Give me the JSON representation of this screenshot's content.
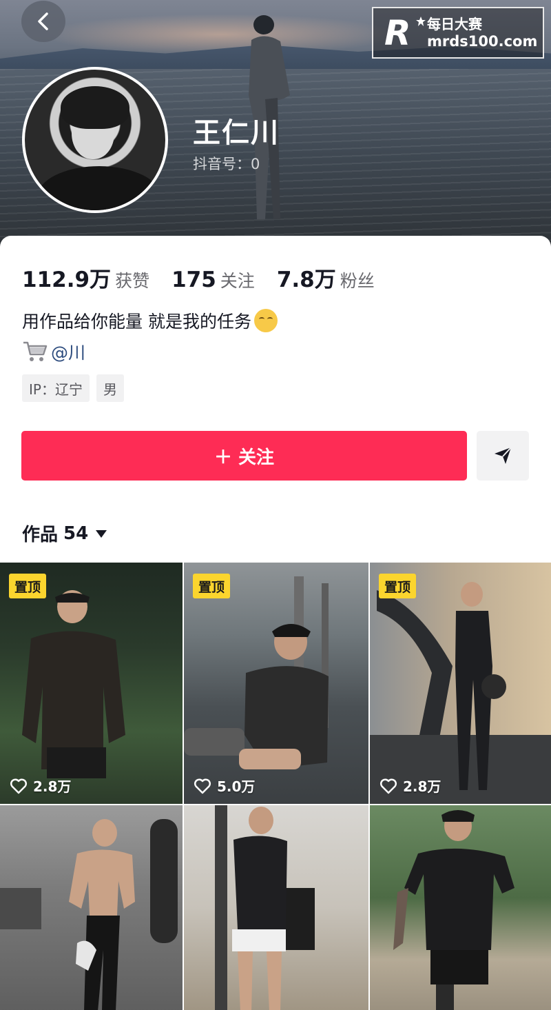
{
  "header": {
    "username": "王仁川",
    "douyin_id": "抖音号：0",
    "watermark_logo": "R",
    "watermark_cn": "每日大赛",
    "watermark_url": "mrds100.com"
  },
  "stats": [
    {
      "num": "112.9万",
      "label": "获赞"
    },
    {
      "num": "175",
      "label": "关注"
    },
    {
      "num": "7.8万",
      "label": "粉丝"
    }
  ],
  "bio": {
    "text": "用作品给你能量 就是我的任务",
    "shop_handle": "@川"
  },
  "tags": [
    "IP：辽宁",
    "男"
  ],
  "actions": {
    "follow_label": "＋ 关注"
  },
  "works": {
    "label": "作品",
    "count": "54"
  },
  "videos": [
    {
      "pinned_label": "置顶",
      "likes": "2.8万"
    },
    {
      "pinned_label": "置顶",
      "likes": "5.0万"
    },
    {
      "pinned_label": "置顶",
      "likes": "2.8万"
    },
    {
      "pinned_label": "",
      "likes": ""
    },
    {
      "pinned_label": "",
      "likes": ""
    },
    {
      "pinned_label": "",
      "likes": ""
    }
  ],
  "colors": {
    "follow_button": "#fe2c55",
    "pin_badge": "#fbd52e",
    "link": "#2d4c7e"
  },
  "icons": {
    "back": "chevron-left-icon",
    "share": "paper-plane-icon",
    "shop": "shopping-cart-icon",
    "like": "heart-outline-icon",
    "works_dropdown": "caret-down-icon"
  }
}
